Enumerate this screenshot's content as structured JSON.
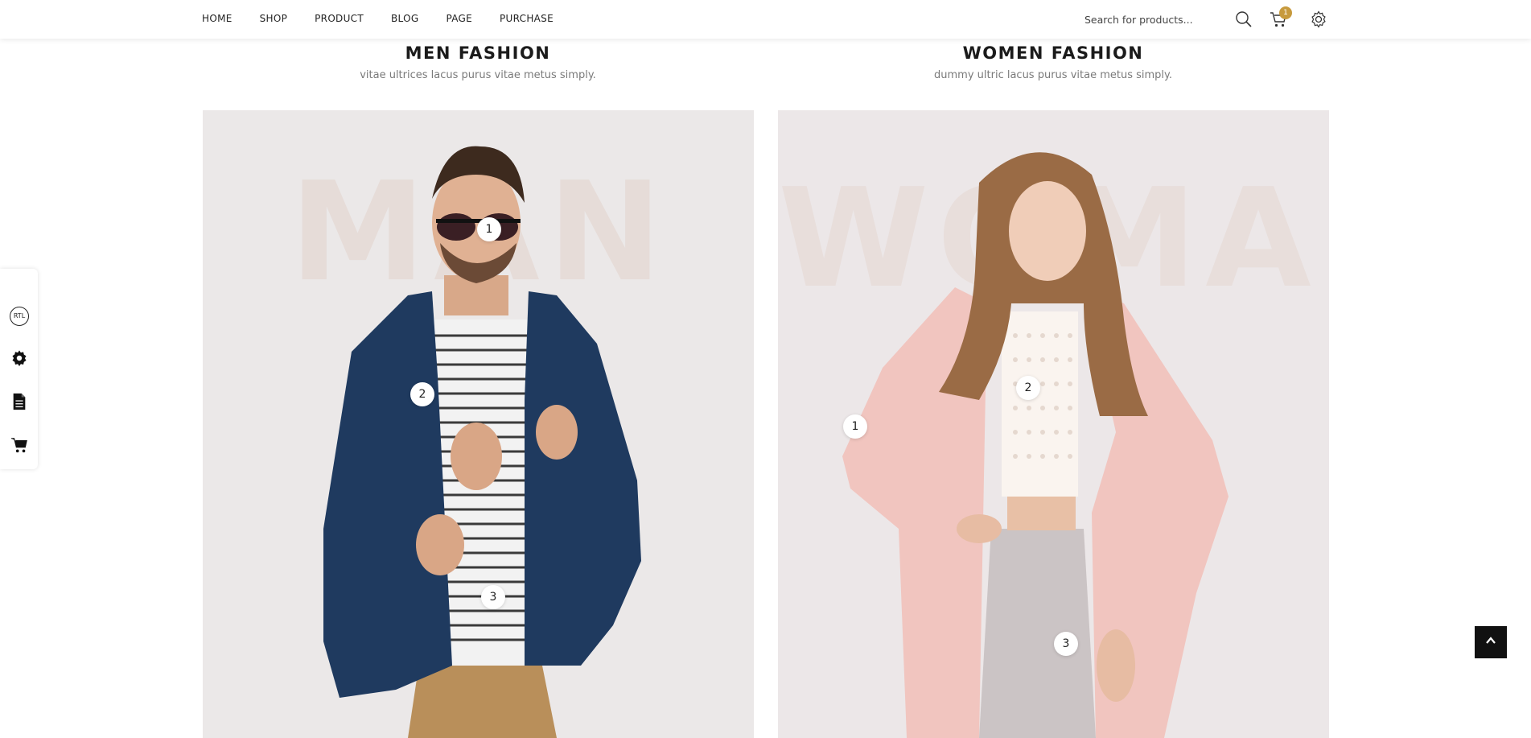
{
  "nav": {
    "items": [
      {
        "label": "HOME"
      },
      {
        "label": "SHOP"
      },
      {
        "label": "PRODUCT"
      },
      {
        "label": "BLOG"
      },
      {
        "label": "PAGE"
      },
      {
        "label": "PURCHASE"
      }
    ]
  },
  "header": {
    "search_placeholder": "Search for products...",
    "cart_count": "1",
    "icons": [
      "search-icon",
      "cart-icon",
      "settings-gear-icon"
    ],
    "accent_color": "#c79a3d"
  },
  "sections": {
    "men": {
      "title": "MEN FASHION",
      "subtitle": "vitae ultrices lacus purus vitae metus simply.",
      "watermark": "MAN",
      "hotspots": [
        "1",
        "2",
        "3"
      ]
    },
    "women": {
      "title": "WOMEN FASHION",
      "subtitle": "dummy ultric lacus purus vitae metus simply.",
      "watermark": "WOMAN",
      "hotspots": [
        "1",
        "2",
        "3"
      ]
    }
  },
  "sidebar": {
    "rtl_label": "RTL",
    "icons": [
      "rtl-icon",
      "settings-gear-icon",
      "document-icon",
      "cart-icon"
    ]
  },
  "back_to_top": {
    "icon": "chevron-up-icon"
  }
}
